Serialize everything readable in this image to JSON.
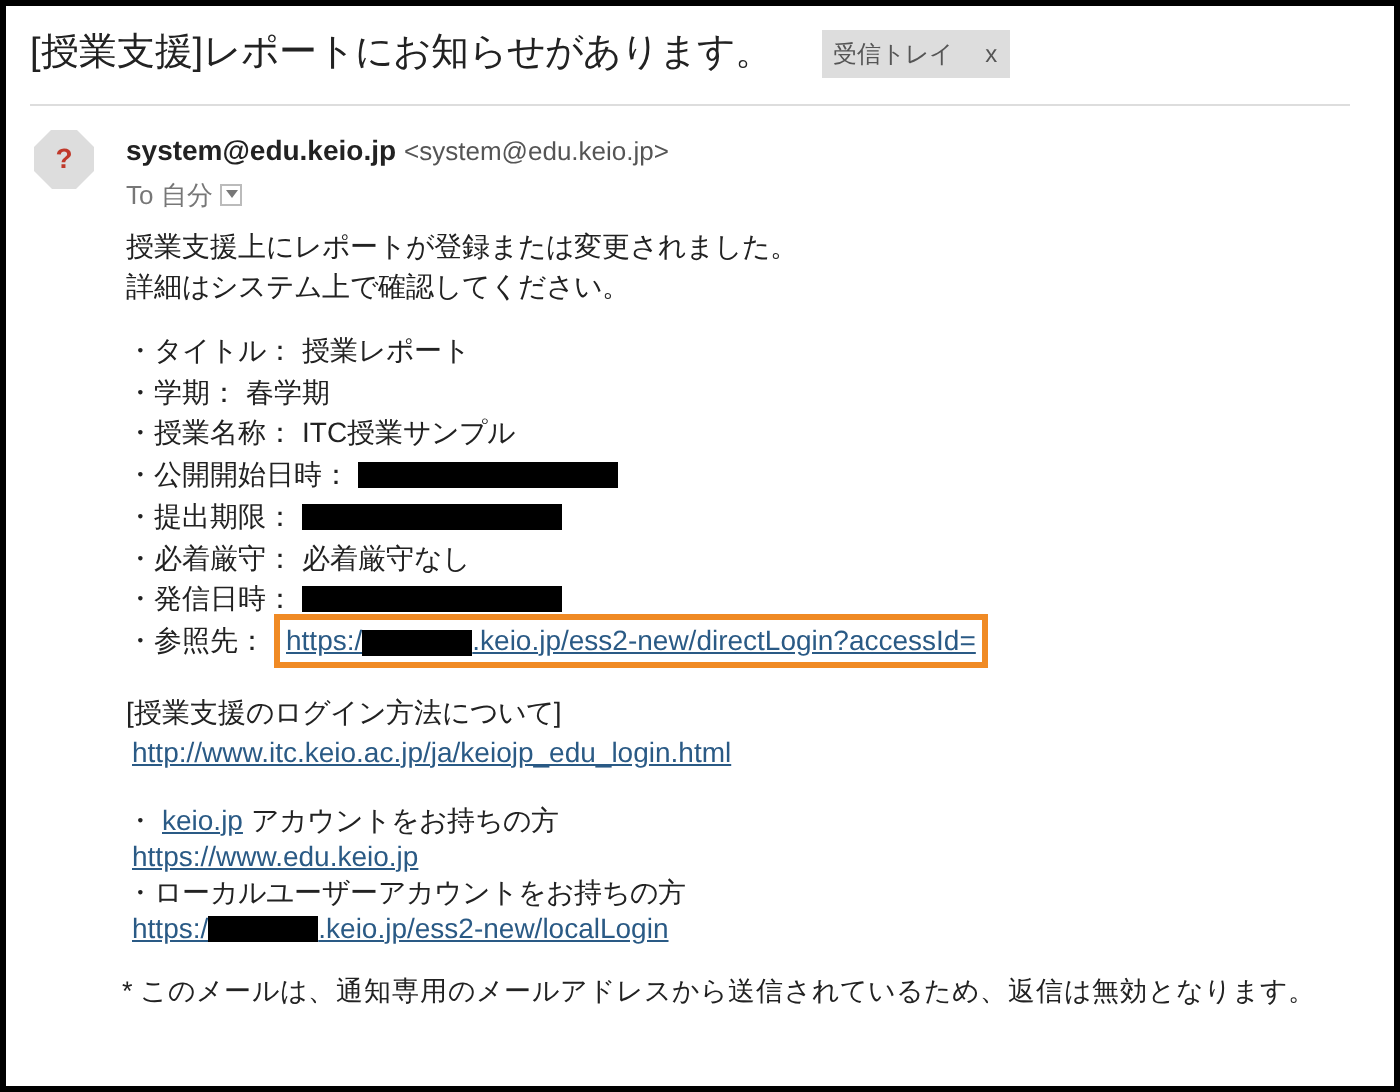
{
  "subject": "[授業支援]レポートにお知らせがあります。",
  "label": {
    "text": "受信トレイ",
    "remove": "x"
  },
  "sender": {
    "avatar": "?",
    "name": "system@edu.keio.jp",
    "address": "<system@edu.keio.jp>",
    "to": "To 自分"
  },
  "intro": [
    "授業支援上にレポートが登録または変更されました。",
    "詳細はシステム上で確認してください。"
  ],
  "details": [
    {
      "kind": "text",
      "label": "・タイトル：",
      "value": "授業レポート"
    },
    {
      "kind": "text",
      "label": "・学期：",
      "value": "春学期"
    },
    {
      "kind": "text",
      "label": "・授業名称：",
      "value": "ITC授業サンプル"
    },
    {
      "kind": "redacted",
      "label": "・公開開始日時："
    },
    {
      "kind": "redacted",
      "label": "・提出期限："
    },
    {
      "kind": "text",
      "label": "・必着厳守：",
      "value": "必着厳守なし"
    },
    {
      "kind": "redacted",
      "label": "・発信日時："
    },
    {
      "kind": "link",
      "label": "・参照先：",
      "prefix": "https:/",
      "suffix": ".keio.jp/ess2-new/directLogin?accessId=",
      "highlighted": true
    }
  ],
  "login_heading": "[授業支援のログイン方法について]",
  "login_link": "http://www.itc.keio.ac.jp/ja/keiojp_edu_login.html",
  "keio_account": {
    "bullet": "・",
    "link": "keio.jp",
    "text": "アカウントをお持ちの方",
    "url": "https://www.edu.keio.jp"
  },
  "local_account": {
    "text": "・ローカルユーザーアカウントをお持ちの方",
    "prefix": "https:/",
    "suffix": ".keio.jp/ess2-new/localLogin"
  },
  "footer": "* このメールは、通知専用のメールアドレスから送信されているため、返信は無効となります。"
}
